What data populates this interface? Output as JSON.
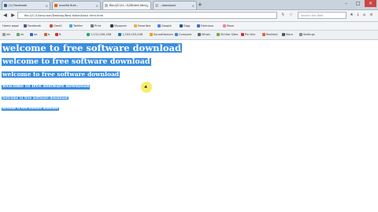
{
  "tabs": [
    {
      "label": "(1) Facebook",
      "color": "#3b5998"
    },
    {
      "label": "mozilla firef...",
      "color": "#e66000"
    },
    {
      "label": "file:///C:/U...%20html.html",
      "color": "#bbbbbb"
    },
    {
      "label": "- download",
      "color": "#bbbbbb"
    }
  ],
  "address_bar": {
    "url": "file:///C:/Users/user/Desktop/New folder/basic html.html"
  },
  "search_box": {
    "placeholder": "Search the Web"
  },
  "bookmarks": [
    "Home page",
    "Facebook",
    "Gmail",
    "Twitter",
    "Print",
    "Myspace",
    "Favorites",
    "Google",
    "Digg",
    "Delicious",
    "Mozs"
  ],
  "toolbar": {
    "items": [
      "ink",
      "nk",
      "aa",
      "b",
      "B",
      "1,231,000,456",
      "1,203,003,456",
      "SoundHeaven",
      "Compare",
      "Whois",
      "Similar Sites",
      "Pin this",
      "Redirect",
      "More",
      "Settings"
    ]
  },
  "headings": [
    "welcome to free software download",
    "welcome to free software download",
    "welcome to free software download",
    "welcome to free software download",
    "welcome to free software download",
    "welcome to free software download"
  ],
  "colors": {
    "selection": "#3b8fe0",
    "cursor_highlight": "#f5e63c"
  }
}
